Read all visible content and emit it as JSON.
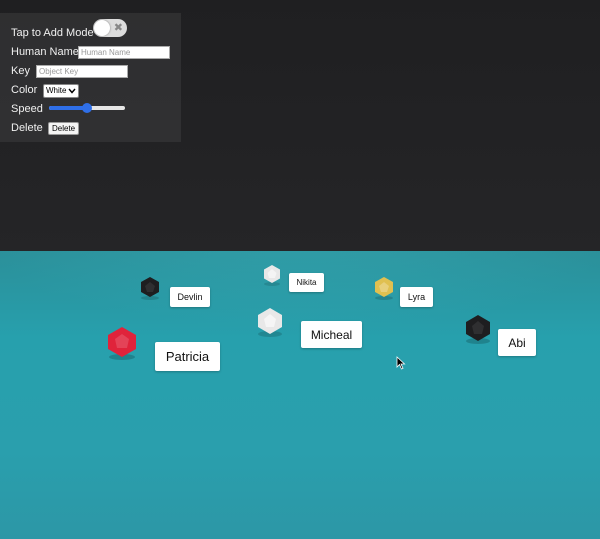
{
  "panel": {
    "tap_mode_label": "Tap to Add Mode",
    "human_name_label": "Human Name",
    "human_name_placeholder": "Human Name",
    "key_label": "Key",
    "key_placeholder": "Object Key",
    "color_label": "Color",
    "color_value": "White",
    "speed_label": "Speed",
    "speed_value": 0.5,
    "delete_label": "Delete",
    "delete_button": "Delete"
  },
  "objects": [
    {
      "name": "Devlin",
      "color": "#1e1e20"
    },
    {
      "name": "Nikita",
      "color": "#e8e8e8"
    },
    {
      "name": "Lyra",
      "color": "#e0c050"
    },
    {
      "name": "Micheal",
      "color": "#e8e8e8"
    },
    {
      "name": "Abi",
      "color": "#1e1e20"
    },
    {
      "name": "Patricia",
      "color": "#e0233b"
    }
  ],
  "colors": {
    "floor": "#2a9fad",
    "background": "#202022",
    "slider_accent": "#2f6fe8"
  }
}
